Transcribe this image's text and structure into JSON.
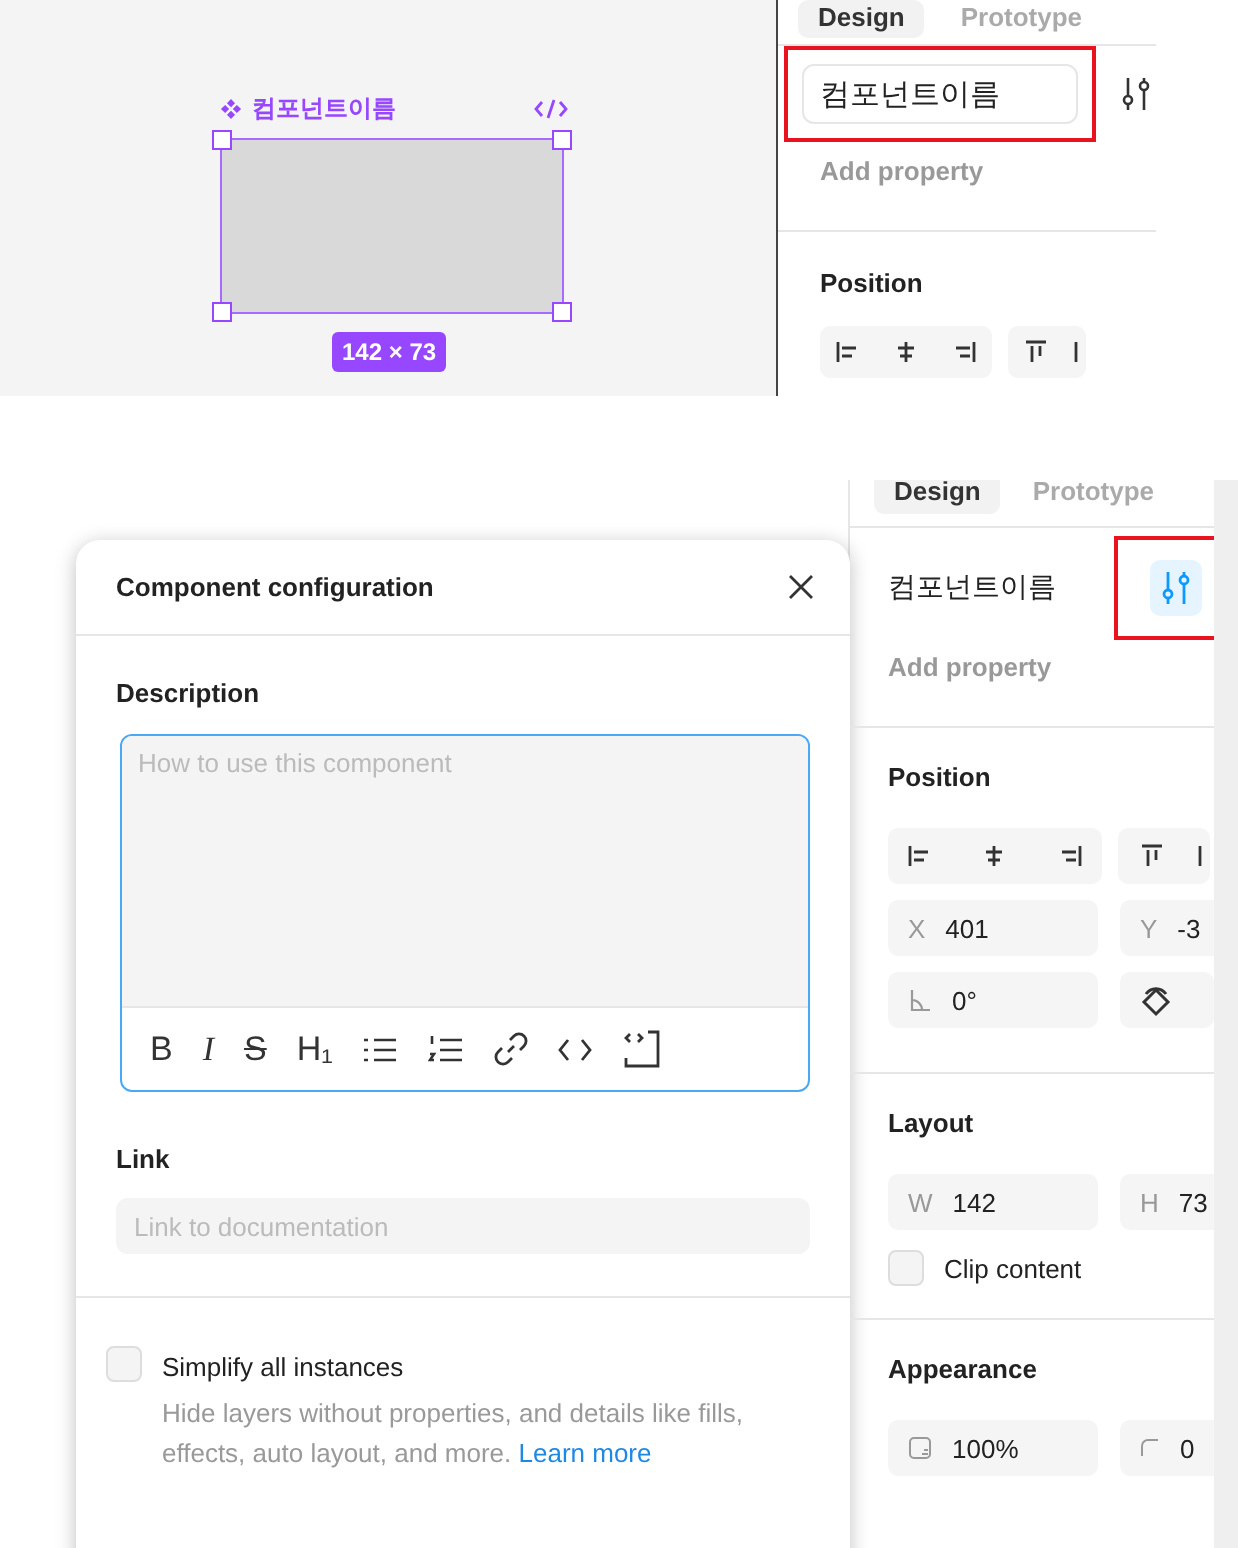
{
  "canvas": {
    "component_name": "컴포넌트이름",
    "size_badge": "142 × 73"
  },
  "top_panel": {
    "tabs": [
      {
        "label": "Design",
        "selected": true
      },
      {
        "label": "Prototype",
        "selected": false
      }
    ],
    "name_field": {
      "value": "컴포넌트이름",
      "highlighted": true
    },
    "add_property": "Add property",
    "position_title": "Position"
  },
  "dialog": {
    "title": "Component configuration",
    "description_label": "Description",
    "description_placeholder": "How to use this component",
    "toolbar": [
      {
        "kind": "bold",
        "label": "B"
      },
      {
        "kind": "italic",
        "label": "I"
      },
      {
        "kind": "strike",
        "label": "S"
      },
      {
        "kind": "heading",
        "label": "H₁"
      },
      {
        "kind": "bullets"
      },
      {
        "kind": "numbered"
      },
      {
        "kind": "link"
      },
      {
        "kind": "code"
      },
      {
        "kind": "codeblock"
      }
    ],
    "link_label": "Link",
    "link_placeholder": "Link to documentation",
    "simplify": {
      "label": "Simplify all instances",
      "checked": false,
      "help": "Hide layers without properties, and details like fills, effects, auto layout, and more.",
      "learn_more": "Learn more"
    }
  },
  "panel": {
    "tabs": [
      {
        "label": "Design",
        "selected": true
      },
      {
        "label": "Prototype",
        "selected": false
      }
    ],
    "component_name": "컴포넌트이름",
    "config_button": {
      "highlighted": true
    },
    "add_property": "Add property",
    "position": {
      "title": "Position",
      "x": {
        "label": "X",
        "value": "401"
      },
      "y": {
        "label": "Y",
        "value": "-3"
      },
      "rotation": "0°"
    },
    "layout": {
      "title": "Layout",
      "w": {
        "label": "W",
        "value": "142"
      },
      "h": {
        "label": "H",
        "value": "73"
      },
      "clip": {
        "label": "Clip content",
        "checked": false
      }
    },
    "appearance": {
      "title": "Appearance",
      "opacity": "100%",
      "radius": "0"
    }
  }
}
